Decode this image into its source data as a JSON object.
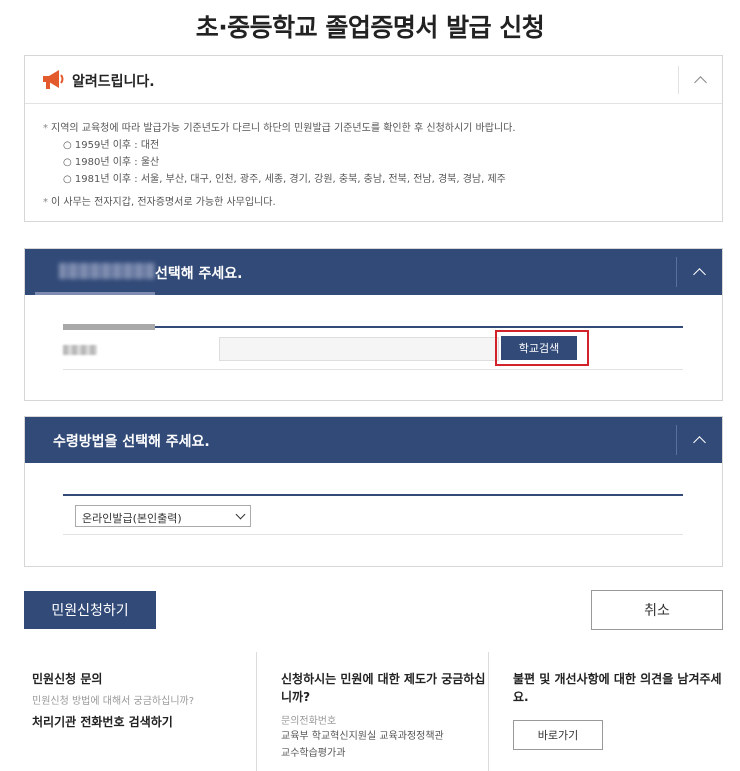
{
  "page": {
    "title": "초·중등학교 졸업증명서 발급 신청"
  },
  "notice": {
    "title": "알려드립니다.",
    "line1": "지역의 교육청에 따라 발급가능 기준년도가 다르니 하단의 민원발급 기준년도를 확인한 후 신청하시기 바랍니다.",
    "items": [
      "○ 1959년 이후 : 대전",
      "○ 1980년 이후 : 울산",
      "○ 1981년 이후 : 서울, 부산, 대구, 인천, 광주, 세종, 경기, 강원, 충북, 충남, 전북, 전남, 경북, 경남, 제주"
    ],
    "line2": "이 사무는 전자지갑, 전자증명서로 가능한 사무입니다."
  },
  "school_section": {
    "title": "선택해 주세요.",
    "search_button": "학교검색"
  },
  "receive_section": {
    "title": "수령방법을 선택해 주세요.",
    "selected_option": "온라인발급(본인출력)"
  },
  "actions": {
    "apply": "민원신청하기",
    "cancel": "취소"
  },
  "footer": {
    "col1": {
      "title": "민원신청 문의",
      "sub": "민원신청 방법에 대해서 궁금하십니까?",
      "link": "처리기관 전화번호 검색하기"
    },
    "col2": {
      "title": "신청하시는 민원에 대한 제도가 궁금하십니까?",
      "label": "문의전화번호",
      "text1": "교육부 학교혁신지원실 교육과정정책관",
      "text2": "교수학습평가과"
    },
    "col3": {
      "title": "불편 및 개선사항에 대한 의견을 남겨주세요.",
      "button": "바로가기"
    }
  },
  "colors": {
    "primary": "#324a78",
    "highlight": "#d2232a"
  }
}
